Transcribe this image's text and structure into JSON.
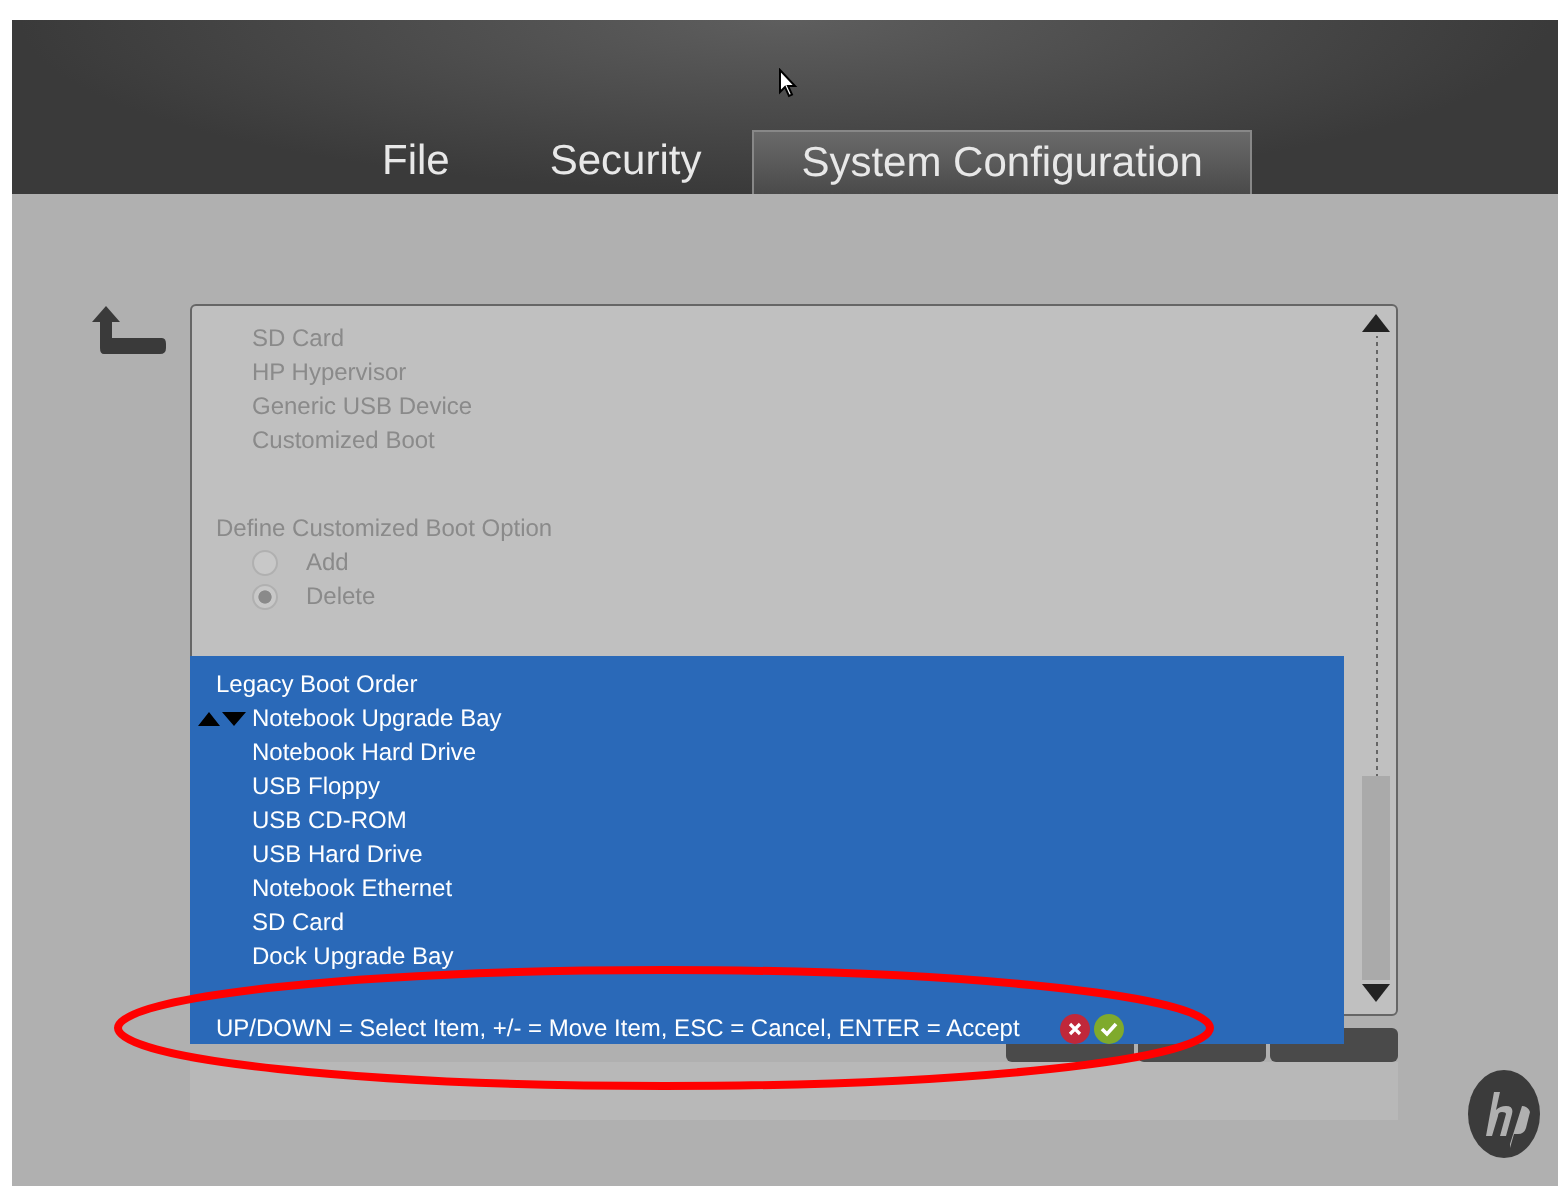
{
  "tabs": [
    {
      "label": "File",
      "selected": false
    },
    {
      "label": "Security",
      "selected": false
    },
    {
      "label": "System Configuration",
      "selected": true
    }
  ],
  "boot_list": {
    "items": [
      "SD Card",
      "HP Hypervisor",
      "Generic USB Device",
      "Customized Boot"
    ]
  },
  "custom_boot_option": {
    "label": "Define Customized Boot Option",
    "options": [
      {
        "label": "Add",
        "checked": false
      },
      {
        "label": "Delete",
        "checked": true
      }
    ]
  },
  "legacy_boot_order": {
    "title": "Legacy Boot Order",
    "items": [
      {
        "label": "Notebook Upgrade Bay",
        "selected": true
      },
      {
        "label": "Notebook Hard Drive",
        "selected": false
      },
      {
        "label": "USB Floppy",
        "selected": false
      },
      {
        "label": "USB CD-ROM",
        "selected": false
      },
      {
        "label": "USB Hard Drive",
        "selected": false
      },
      {
        "label": "Notebook Ethernet",
        "selected": false
      },
      {
        "label": "SD Card",
        "selected": false
      },
      {
        "label": "Dock Upgrade Bay",
        "selected": false
      }
    ],
    "help": "UP/DOWN = Select Item, +/- = Move Item,  ESC = Cancel,  ENTER = Accept"
  }
}
